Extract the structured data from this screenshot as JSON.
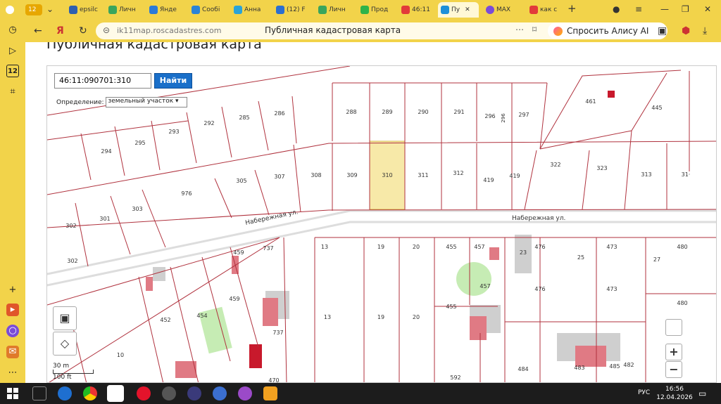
{
  "browser": {
    "tab_count": "12",
    "tabs": [
      {
        "label": "epsilc",
        "color": "#2d5fb0"
      },
      {
        "label": "Личн",
        "color": "#3aa55d"
      },
      {
        "label": "Янде",
        "color": "#2a7ad8"
      },
      {
        "label": "Сообі",
        "color": "#2b83d6"
      },
      {
        "label": "Анна",
        "color": "#2aa3d8"
      },
      {
        "label": "(12) F",
        "color": "#2b6fcf"
      },
      {
        "label": "Личн",
        "color": "#3aa55d"
      },
      {
        "label": "Прод",
        "color": "#2fb34a"
      },
      {
        "label": "46:11",
        "color": "#e23a3a"
      },
      {
        "label": "Пу",
        "color": "#1e90d8"
      },
      {
        "label": "MAX",
        "color": "#7a4cd8"
      },
      {
        "label": "как с",
        "color": "#e23a3a"
      }
    ],
    "url_host": "ik11map.roscadastres.com",
    "page_title": "Публичная кадастровая карта",
    "alice_label": "Спросить Алису AI"
  },
  "page": {
    "heading": "Публичная кадастровая карта"
  },
  "map": {
    "search_value": "46:11:090701:310",
    "search_button": "Найти",
    "define_label": "Определение:",
    "define_value": "земельный участок",
    "zoom_in": "+",
    "zoom_out": "−",
    "scale_m": "30 m",
    "scale_ft": "100 ft",
    "streets": [
      "Набережная ул.",
      "Набережная ул."
    ],
    "selected_parcel": "310",
    "parcels_north": [
      "294",
      "295",
      "293",
      "292",
      "285",
      "286",
      "288",
      "289",
      "290",
      "291",
      "296",
      "296",
      "297",
      "461",
      "445"
    ],
    "parcels_middle": [
      "302",
      "301",
      "303",
      "976",
      "305",
      "307",
      "308",
      "309",
      "310",
      "311",
      "312",
      "419",
      "419",
      "322",
      "323",
      "313",
      "31·"
    ],
    "parcels_south": [
      "302",
      "459",
      "737",
      "13",
      "19",
      "20",
      "455",
      "457",
      "23",
      "476",
      "25",
      "473",
      "27",
      "480",
      "457",
      "476",
      "473",
      "480",
      "452",
      "454",
      "459",
      "737",
      "13",
      "19",
      "20",
      "455",
      "10",
      "484",
      "483",
      "485",
      "482",
      "470",
      "592"
    ],
    "highlight_color": "#f7e9a8"
  },
  "taskbar": {
    "lang": "РУС",
    "time": "16:56",
    "date": "12.04.2026"
  }
}
